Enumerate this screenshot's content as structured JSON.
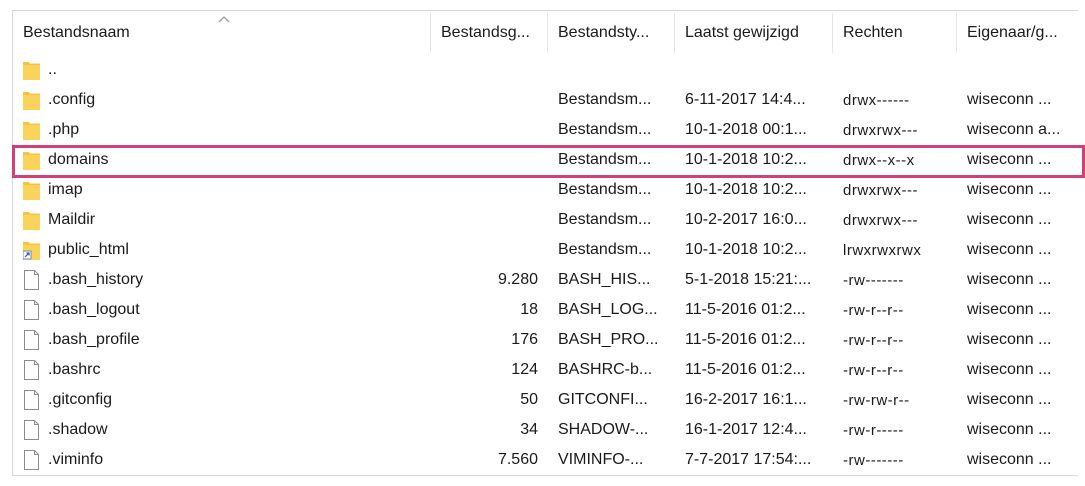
{
  "columns": [
    {
      "label": "Bestandsnaam"
    },
    {
      "label": "Bestandsg..."
    },
    {
      "label": "Bestandsty..."
    },
    {
      "label": "Laatst gewijzigd"
    },
    {
      "label": "Rechten"
    },
    {
      "label": "Eigenaar/g..."
    }
  ],
  "sort": {
    "column": "Bestandsnaam",
    "icon": "sort-ascending-icon"
  },
  "colors": {
    "highlight_border": "#d1407a",
    "folder": "#f5c542"
  },
  "rows": [
    {
      "name": "..",
      "icon": "folder-icon",
      "size": "",
      "type": "",
      "modified": "",
      "perms": "",
      "owner": ""
    },
    {
      "name": ".config",
      "icon": "folder-icon",
      "size": "",
      "type": "Bestandsm...",
      "modified": "6-11-2017 14:4...",
      "perms": "drwx------",
      "owner": "wiseconn ..."
    },
    {
      "name": ".php",
      "icon": "folder-icon",
      "size": "",
      "type": "Bestandsm...",
      "modified": "10-1-2018 00:1...",
      "perms": "drwxrwx---",
      "owner": "wiseconn a..."
    },
    {
      "name": "domains",
      "icon": "folder-icon",
      "size": "",
      "type": "Bestandsm...",
      "modified": "10-1-2018 10:2...",
      "perms": "drwx--x--x",
      "owner": "wiseconn ..."
    },
    {
      "name": "imap",
      "icon": "folder-icon",
      "size": "",
      "type": "Bestandsm...",
      "modified": "10-1-2018 10:2...",
      "perms": "drwxrwx---",
      "owner": "wiseconn ..."
    },
    {
      "name": "Maildir",
      "icon": "folder-icon",
      "size": "",
      "type": "Bestandsm...",
      "modified": "10-2-2017 16:0...",
      "perms": "drwxrwx---",
      "owner": "wiseconn ..."
    },
    {
      "name": "public_html",
      "icon": "folder-shortcut-icon",
      "size": "",
      "type": "Bestandsm...",
      "modified": "10-1-2018 10:2...",
      "perms": "lrwxrwxrwx",
      "owner": "wiseconn ..."
    },
    {
      "name": ".bash_history",
      "icon": "file-icon",
      "size": "9.280",
      "type": "BASH_HIS...",
      "modified": "5-1-2018 15:21:...",
      "perms": "-rw-------",
      "owner": "wiseconn ..."
    },
    {
      "name": ".bash_logout",
      "icon": "file-icon",
      "size": "18",
      "type": "BASH_LOG...",
      "modified": "11-5-2016 01:2...",
      "perms": "-rw-r--r--",
      "owner": "wiseconn ..."
    },
    {
      "name": ".bash_profile",
      "icon": "file-icon",
      "size": "176",
      "type": "BASH_PRO...",
      "modified": "11-5-2016 01:2...",
      "perms": "-rw-r--r--",
      "owner": "wiseconn ..."
    },
    {
      "name": ".bashrc",
      "icon": "file-icon",
      "size": "124",
      "type": "BASHRC-b...",
      "modified": "11-5-2016 01:2...",
      "perms": "-rw-r--r--",
      "owner": "wiseconn ..."
    },
    {
      "name": ".gitconfig",
      "icon": "file-icon",
      "size": "50",
      "type": "GITCONFI...",
      "modified": "16-2-2017 16:1...",
      "perms": "-rw-rw-r--",
      "owner": "wiseconn ..."
    },
    {
      "name": ".shadow",
      "icon": "file-icon",
      "size": "34",
      "type": "SHADOW-...",
      "modified": "16-1-2017 12:4...",
      "perms": "-rw-r-----",
      "owner": "wiseconn ..."
    },
    {
      "name": ".viminfo",
      "icon": "file-icon",
      "size": "7.560",
      "type": "VIMINFO-...",
      "modified": "7-7-2017 17:54:...",
      "perms": "-rw-------",
      "owner": "wiseconn ..."
    }
  ]
}
